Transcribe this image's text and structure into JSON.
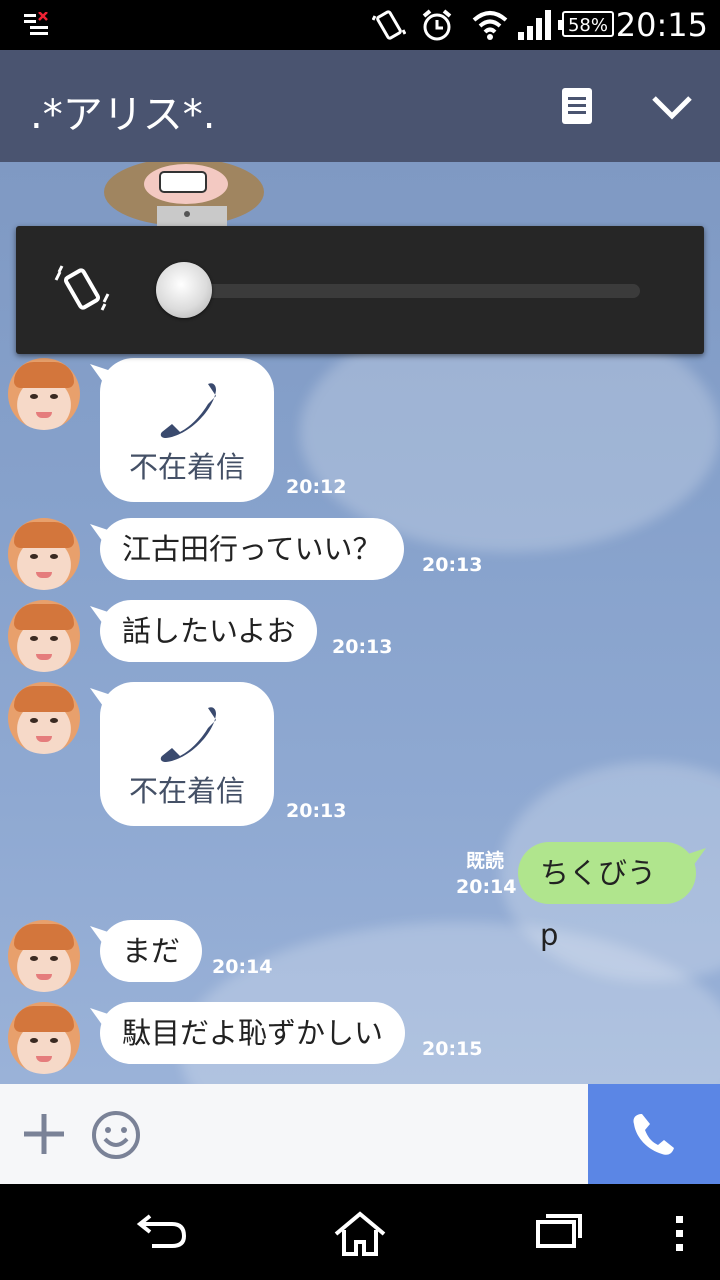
{
  "status_bar": {
    "battery": "58%",
    "time": "20:15"
  },
  "header": {
    "title": ".*アリス*."
  },
  "volume_overlay": {
    "level": 0,
    "mode_icon": "vibrate-icon"
  },
  "messages": [
    {
      "type": "missed_call",
      "label": "不在着信",
      "time": "20:12"
    },
    {
      "type": "text",
      "text": "江古田行っていい？",
      "time": "20:13"
    },
    {
      "type": "text",
      "text": "話したいよお",
      "time": "20:13"
    },
    {
      "type": "missed_call",
      "label": "不在着信",
      "time": "20:13"
    },
    {
      "type": "sent",
      "text": "ちくびうp",
      "read_label": "既読",
      "time": "20:14"
    },
    {
      "type": "text",
      "text": "まだ",
      "time": "20:14"
    },
    {
      "type": "text",
      "text": "駄目だよ恥ずかしい",
      "time": "20:15"
    }
  ],
  "colors": {
    "header": "#4a5470",
    "call_button": "#5b86e5",
    "sent_bubble": "#b0e58d"
  }
}
